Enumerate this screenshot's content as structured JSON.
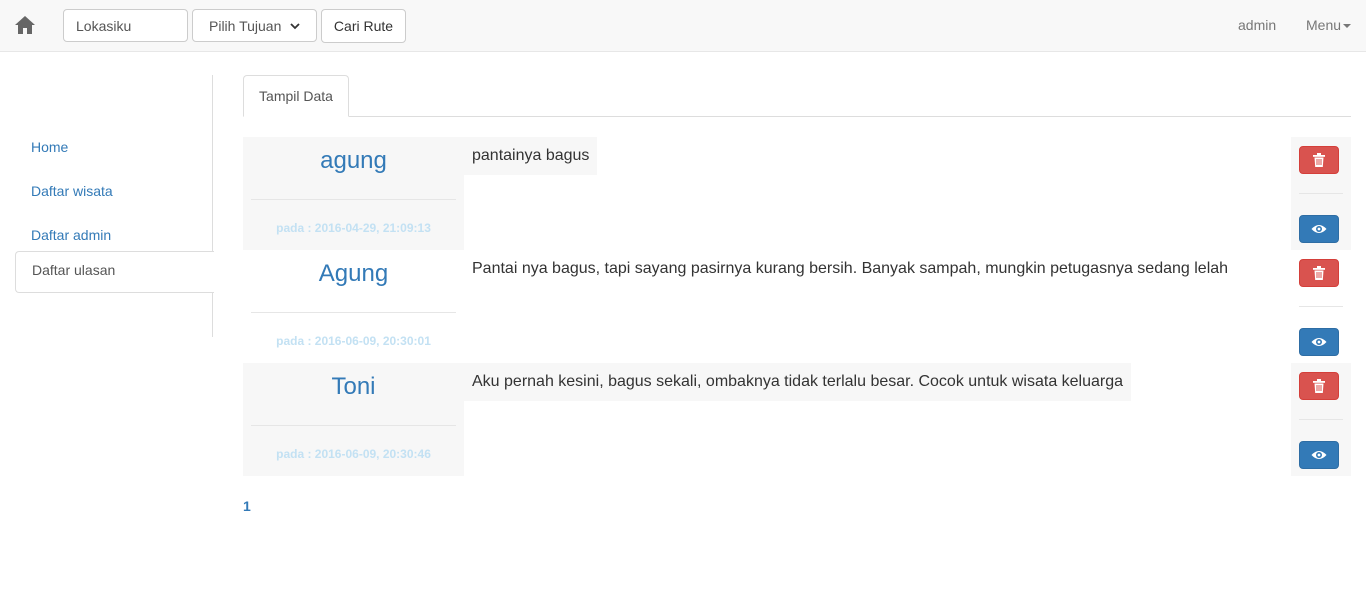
{
  "navbar": {
    "location_value": "Lokasiku",
    "destination_selected": "Pilih Tujuan",
    "route_button": "Cari Rute",
    "user": "admin",
    "menu": "Menu"
  },
  "sidebar": {
    "items": [
      {
        "label": "Home"
      },
      {
        "label": "Daftar wisata"
      },
      {
        "label": "Daftar admin"
      },
      {
        "label": "Daftar ulasan"
      }
    ]
  },
  "tabs": [
    {
      "label": "Tampil Data"
    }
  ],
  "reviews": [
    {
      "name": "agung",
      "date": "pada : 2016-04-29, 21:09:13",
      "text": "pantainya bagus"
    },
    {
      "name": "Agung",
      "date": "pada : 2016-06-09, 20:30:01",
      "text": "Pantai nya bagus, tapi sayang pasirnya kurang bersih. Banyak sampah, mungkin petugasnya sedang lelah"
    },
    {
      "name": "Toni",
      "date": "pada : 2016-06-09, 20:30:46",
      "text": "Aku pernah kesini, bagus sekali, ombaknya tidak terlalu besar. Cocok untuk wisata keluarga"
    }
  ],
  "pagination": {
    "current": "1"
  },
  "icons": {
    "home": "home-icon",
    "delete": "trash-icon",
    "view": "eye-icon",
    "dropdown": "chevron-down-icon"
  },
  "colors": {
    "link": "#337ab7",
    "danger": "#d9534f",
    "primary": "#337ab7"
  }
}
